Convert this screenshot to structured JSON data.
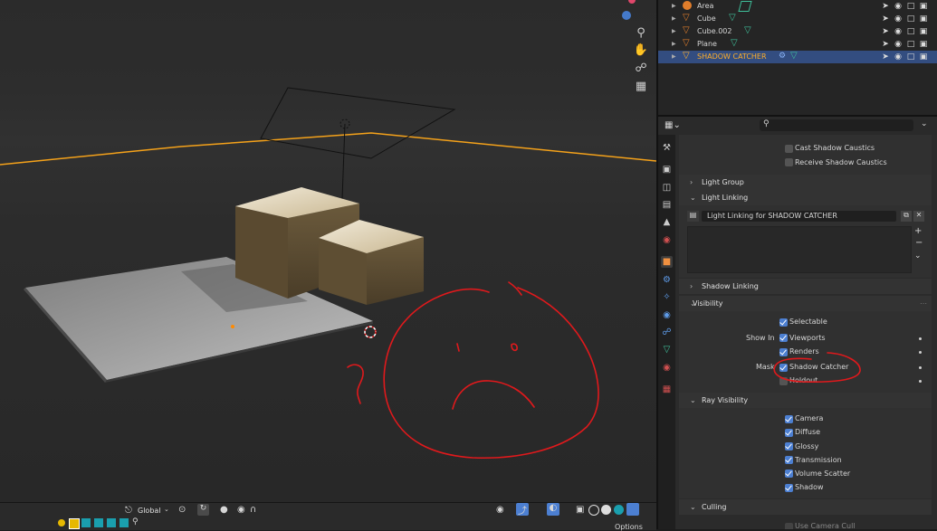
{
  "outliner": {
    "rows": [
      {
        "name": "Area",
        "type": "light"
      },
      {
        "name": "Cube",
        "type": "mesh"
      },
      {
        "name": "Cube.002",
        "type": "mesh"
      },
      {
        "name": "Plane",
        "type": "mesh"
      },
      {
        "name": "SHADOW CATCHER",
        "type": "mesh",
        "selected": true
      }
    ]
  },
  "properties": {
    "search_placeholder": "",
    "cast_shadow_caustics": "Cast Shadow Caustics",
    "receive_shadow_caustics": "Receive Shadow Caustics",
    "light_group": "Light Group",
    "light_linking": "Light Linking",
    "light_linking_collection": "Light Linking for SHADOW CATCHER",
    "shadow_linking": "Shadow Linking",
    "visibility": "Visibility",
    "selectable": "Selectable",
    "show_in": "Show In",
    "viewports": "Viewports",
    "renders": "Renders",
    "mask": "Mask",
    "shadow_catcher": "Shadow Catcher",
    "holdout": "Holdout",
    "ray_visibility": "Ray Visibility",
    "camera": "Camera",
    "diffuse": "Diffuse",
    "glossy": "Glossy",
    "transmission": "Transmission",
    "volume_scatter": "Volume Scatter",
    "shadow": "Shadow",
    "culling": "Culling",
    "use_camera_cull": "Use Camera Cull"
  },
  "viewport_header": {
    "orientation": "Global",
    "options": "Options"
  },
  "colors": {
    "accent_blue": "#4c7fd1",
    "selection_row": "#334d80",
    "selected_text": "#ffaf29",
    "annotation_red": "#e0191c",
    "horizon_orange": "#f5a21a"
  }
}
